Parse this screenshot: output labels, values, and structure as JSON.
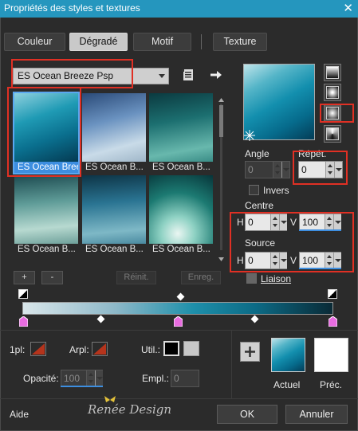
{
  "window": {
    "title": "Propriétés des styles et textures",
    "close": "✕"
  },
  "tabs": [
    "Couleur",
    "Dégradé",
    "Motif",
    "Texture"
  ],
  "gradient_select": {
    "value": "ES Ocean Breeze Psp"
  },
  "thumbnails": [
    {
      "label": "ES Ocean Breeze Psp"
    },
    {
      "label": "ES Ocean B..."
    },
    {
      "label": "ES Ocean B..."
    },
    {
      "label": "ES Ocean B..."
    },
    {
      "label": "ES Ocean B..."
    },
    {
      "label": "ES Ocean B..."
    }
  ],
  "list_buttons": {
    "add": "+",
    "remove": "-",
    "reset": "Réinit.",
    "save": "Enreg."
  },
  "angle": {
    "label": "Angle",
    "value": "0"
  },
  "repeat": {
    "label": "Répét.",
    "value": "0"
  },
  "invert": {
    "label": "Invers"
  },
  "center": {
    "label": "Centre",
    "h_label": "H",
    "h_value": "0",
    "v_label": "V",
    "v_value": "100"
  },
  "source": {
    "label": "Source",
    "h_label": "H",
    "h_value": "0",
    "v_label": "V",
    "v_value": "100"
  },
  "link": {
    "label": "Liaison"
  },
  "stops": {
    "first_plan": {
      "label": "1pl:"
    },
    "arrplan": {
      "label": "Arpl:"
    },
    "util": {
      "label": "Util.:"
    },
    "opacity": {
      "label": "Opacité:",
      "value": "100"
    },
    "location": {
      "label": "Empl.:",
      "value": "0"
    }
  },
  "swatches": {
    "current_label": "Actuel",
    "previous_label": "Préc."
  },
  "footer": {
    "help": "Aide",
    "watermark": "Renée Design",
    "ok": "OK",
    "cancel": "Annuler"
  },
  "colors": {
    "accent": "#3d8ee0",
    "highlight": "#e03024",
    "titlebar": "#2596be"
  }
}
